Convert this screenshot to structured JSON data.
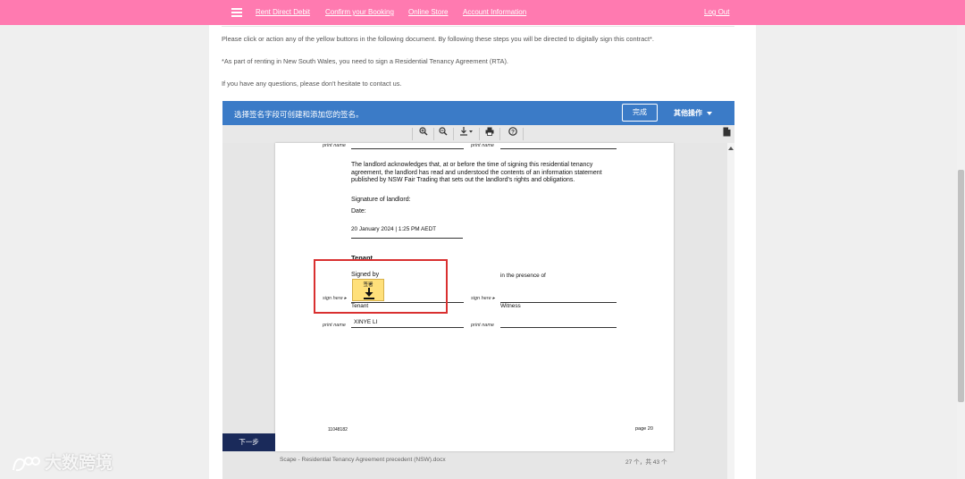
{
  "nav": {
    "links": [
      "Rent Direct Debit",
      "Confirm your Booking",
      "Online Store",
      "Account Information"
    ],
    "logout": "Log Out"
  },
  "intro": {
    "p1": "Please click or action any of the yellow buttons in the following document. By following these steps you will be directed to digitally sign this contract*.",
    "p2": "*As part of renting in New South Wales, you need to sign a Residential Tenancy Agreement (RTA).",
    "p3": "If you have any questions, please don't hesitate to contact us."
  },
  "docbar": {
    "title": "选择签名字段可创建和添加您的签名。",
    "finish": "完成",
    "more": "其他操作"
  },
  "toolbar": [
    "zoom-in-icon",
    "zoom-out-icon",
    "download-icon",
    "print-icon",
    "help-icon"
  ],
  "document": {
    "print_name_label": "print name",
    "ack_text": "The landlord acknowledges that, at or before the time of signing this residential tenancy agreement, the landlord has read and understood the contents of an information statement published by NSW Fair Trading that sets out the landlord's rights and obligations.",
    "sig_landlord": "Signature of landlord:",
    "date_label": "Date:",
    "date_value": "20 January 2024 | 1:25 PM AEDT",
    "tenant_heading": "Tenant",
    "signed_by": "Signed by",
    "presence": "in the presence of",
    "sign_here": "sign here ▸",
    "tenant_label": "Tenant",
    "witness_label": "Witness",
    "tenant_name": "XINYE LI",
    "sign_button": "签署",
    "doc_id": "11048182",
    "page_label": "page 20"
  },
  "next_button": "下一步",
  "footer": {
    "filename": "Scape - Residential Tenancy Agreement precedent (NSW).docx",
    "pages": "27 个，共 43 个"
  },
  "watermark": "大数跨境",
  "colors": {
    "topbar": "#ff7ab0",
    "docbar": "#3b7bc7",
    "sign_button": "#ffe07a",
    "highlight": "#d93030"
  }
}
